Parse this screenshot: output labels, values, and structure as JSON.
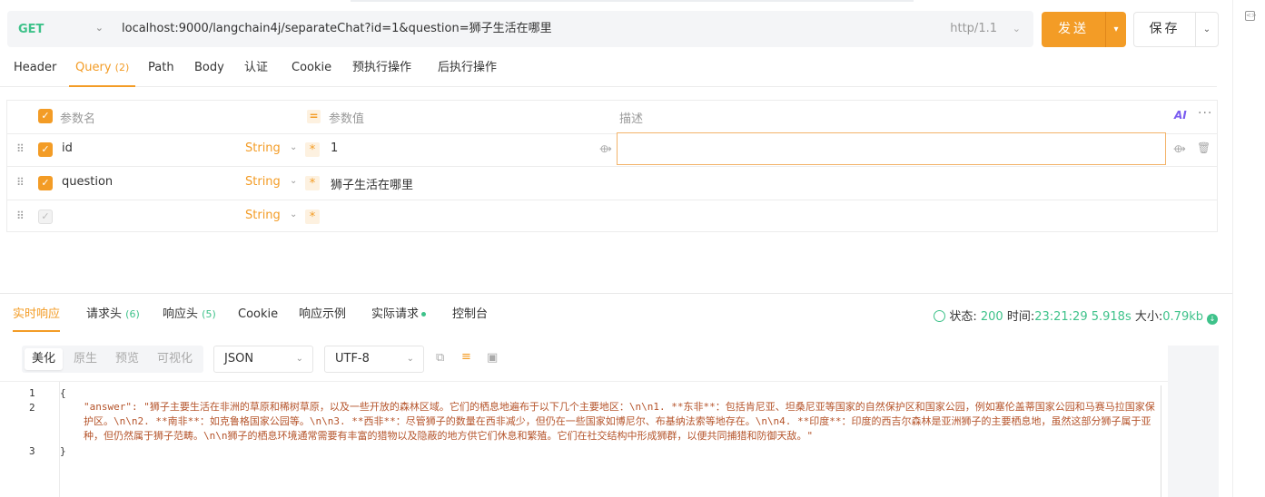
{
  "request": {
    "method": "GET",
    "url": "localhost:9000/langchain4j/separateChat?id=1&question=狮子生活在哪里",
    "protocol": "http/1.1",
    "send_label": "发送",
    "save_label": "保存"
  },
  "req_tabs": [
    {
      "label": "Header",
      "count": ""
    },
    {
      "label": "Query",
      "count": "(2)"
    },
    {
      "label": "Path",
      "count": ""
    },
    {
      "label": "Body",
      "count": ""
    },
    {
      "label": "认证",
      "count": ""
    },
    {
      "label": "Cookie",
      "count": ""
    },
    {
      "label": "预执行操作",
      "count": ""
    },
    {
      "label": "后执行操作",
      "count": ""
    }
  ],
  "params_table": {
    "headers": {
      "name": "参数名",
      "value": "参数值",
      "desc": "描述",
      "ai": "AI"
    },
    "rows": [
      {
        "name": "id",
        "type": "String",
        "value": "1",
        "checked": true
      },
      {
        "name": "question",
        "type": "String",
        "value": "狮子生活在哪里",
        "checked": true
      },
      {
        "name": "",
        "type": "String",
        "value": "",
        "checked": false
      }
    ]
  },
  "resp_tabs": [
    {
      "label": "实时响应",
      "count": ""
    },
    {
      "label": "请求头",
      "count": "(6)"
    },
    {
      "label": "响应头",
      "count": "(5)"
    },
    {
      "label": "Cookie",
      "count": ""
    },
    {
      "label": "响应示例",
      "count": ""
    },
    {
      "label": "实际请求",
      "count": ""
    },
    {
      "label": "控制台",
      "count": ""
    }
  ],
  "status": {
    "status_label": "状态:",
    "status_value": "200",
    "time_label": "时间:",
    "time_value": "23:21:29",
    "duration": "5.918s",
    "size_label": "大小:",
    "size_value": "0.79kb"
  },
  "view_modes": [
    "美化",
    "原生",
    "预览",
    "可视化"
  ],
  "format": "JSON",
  "encoding": "UTF-8",
  "code": {
    "line_numbers": [
      "1",
      "2",
      "3"
    ],
    "open_brace": "{",
    "close_brace": "}",
    "answer_key": "\"answer\": ",
    "answer_value": "\"狮子主要生活在非洲的草原和稀树草原，以及一些开放的森林区域。它们的栖息地遍布于以下几个主要地区：\\n\\n1. **东非**：包括肯尼亚、坦桑尼亚等国家的自然保护区和国家公园，例如塞伦盖蒂国家公园和马赛马拉国家保护区。\\n\\n2. **南非**：如克鲁格国家公园等。\\n\\n3. **西非**：尽管狮子的数量在西非减少，但仍在一些国家如博尼尔、布基纳法索等地存在。\\n\\n4. **印度**：印度的西吉尔森林是亚洲狮子的主要栖息地，虽然这部分狮子属于亚种，但仍然属于狮子范畴。\\n\\n狮子的栖息环境通常需要有丰富的猎物以及隐蔽的地方供它们休息和繁殖。它们在社交结构中形成狮群，以便共同捕猎和防御天敌。\""
  },
  "colors": {
    "accent": "#f39c26",
    "success": "#3ec28a"
  }
}
